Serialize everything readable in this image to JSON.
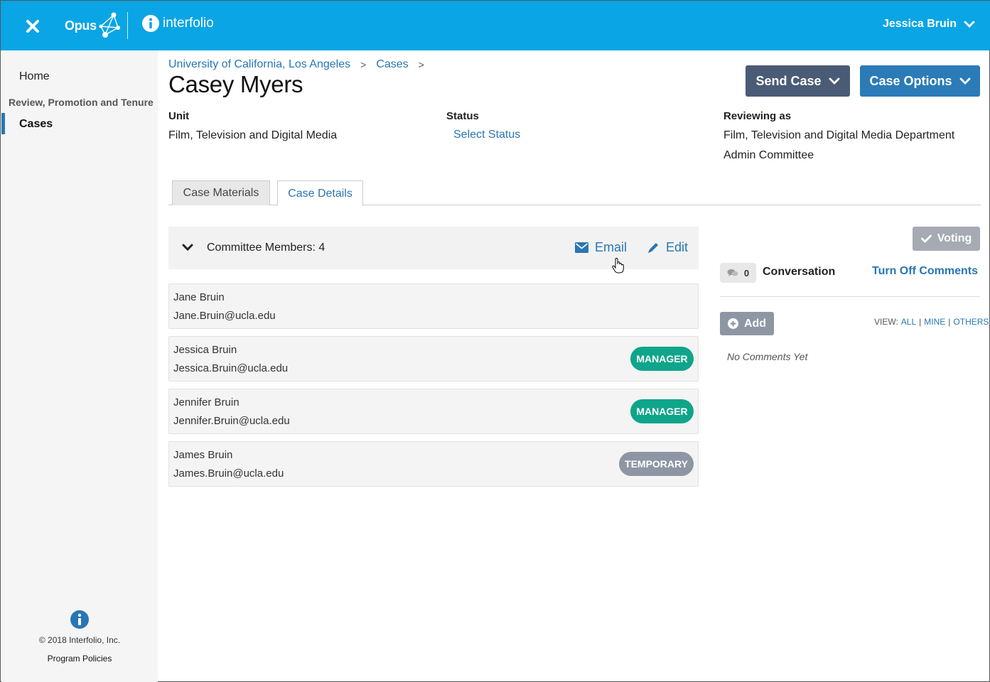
{
  "topbar": {
    "brand": "Opus",
    "partner": "interfolio",
    "user_name": "Jessica Bruin",
    "icons": [
      "close-icon",
      "info-icon",
      "chevron-down-icon"
    ]
  },
  "sidebar": {
    "home": "Home",
    "section": "Review, Promotion and Tenure",
    "active_item": "Cases",
    "copyright": "© 2018 Interfolio, Inc.",
    "policies": "Program Policies"
  },
  "breadcrumb": {
    "items": [
      "University of California, Los Angeles",
      "Cases"
    ],
    "separator": ">"
  },
  "page": {
    "title": "Casey Myers"
  },
  "actions": {
    "send_case": "Send Case",
    "case_options": "Case Options"
  },
  "info": {
    "unit_label": "Unit",
    "unit_value": "Film, Television and Digital Media",
    "status_label": "Status",
    "status_value": "Select Status",
    "reviewing_label": "Reviewing as",
    "reviewing_line1": "Film, Television and Digital Media Department",
    "reviewing_line2": "Admin Committee"
  },
  "tabs": [
    {
      "label": "Case Materials",
      "active": false
    },
    {
      "label": "Case Details",
      "active": true
    }
  ],
  "committee": {
    "title": "Committee Members: 4",
    "email": "Email",
    "edit": "Edit",
    "members": [
      {
        "name": "Jane Bruin",
        "email": "Jane.Bruin@ucla.edu",
        "badge": ""
      },
      {
        "name": "Jessica Bruin",
        "email": "Jessica.Bruin@ucla.edu",
        "badge": "MANAGER"
      },
      {
        "name": "Jennifer Bruin",
        "email": "Jennifer.Bruin@ucla.edu",
        "badge": "MANAGER"
      },
      {
        "name": "James Bruin",
        "email": "James.Bruin@ucla.edu",
        "badge": "TEMPORARY"
      }
    ]
  },
  "conversation": {
    "voting": "Voting",
    "count": "0",
    "title": "Conversation",
    "turn_off": "Turn Off Comments",
    "add": "Add",
    "view_label": "VIEW:",
    "view_all": "ALL",
    "view_mine": "MINE",
    "view_others": "OTHERS'",
    "empty": "No Comments Yet"
  },
  "colors": {
    "topbar": "#0aa5e4",
    "link": "#2876b4",
    "send_case": "#4a5b76",
    "case_options": "#2b7bb8",
    "manager_badge": "#0fa58a",
    "temporary_badge": "#8e96a4"
  }
}
